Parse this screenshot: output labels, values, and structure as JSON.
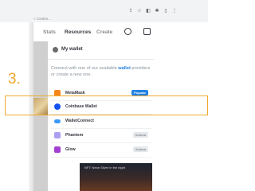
{
  "browser": {
    "breadcrumb": "» Conten..."
  },
  "nav": {
    "links": [
      {
        "label": "Stats"
      },
      {
        "label": "Resources"
      },
      {
        "label": "Create"
      }
    ]
  },
  "wallet_panel": {
    "title": "My wallet",
    "description_prefix": "Connect with one of our available ",
    "description_link": "wallet",
    "description_suffix": " providers or create a new one.",
    "rows": [
      {
        "label": "MetaMask",
        "badge": "Popular"
      },
      {
        "label": "Coinbase Wallet",
        "badge": ""
      },
      {
        "label": "WalletConnect",
        "badge": ""
      },
      {
        "label": "Phantom",
        "badge": "Solana"
      },
      {
        "label": "Glow",
        "badge": "Solana"
      }
    ]
  },
  "annotation": {
    "step": "3."
  },
  "game_card": {
    "title": "NFT: Neon Silver in the night"
  },
  "colors": {
    "highlight": "#f0a92e",
    "accent": "#2081e2"
  }
}
